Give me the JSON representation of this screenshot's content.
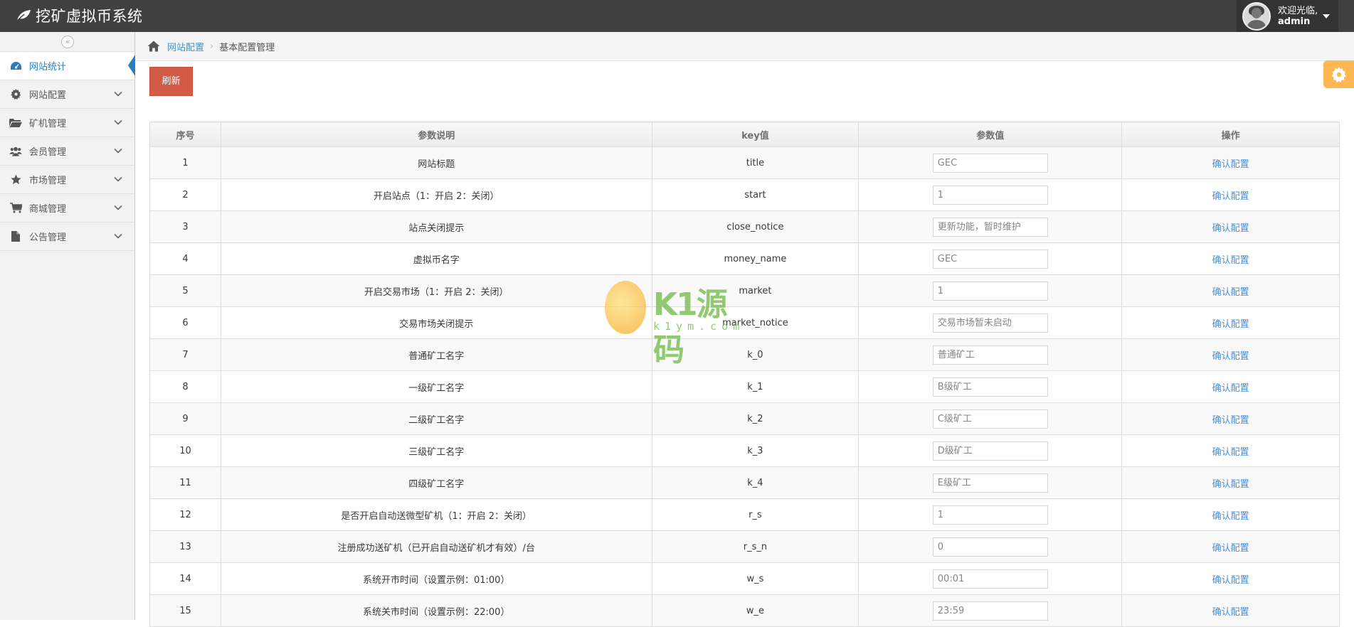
{
  "app": {
    "title": "挖矿虚拟币系统"
  },
  "user": {
    "greeting": "欢迎光临,",
    "name": "admin"
  },
  "sidebar": {
    "collapse_label": "«",
    "items": [
      {
        "label": "网站统计",
        "icon": "dashboard-icon",
        "active": true
      },
      {
        "label": "网站配置",
        "icon": "gear-icon"
      },
      {
        "label": "矿机管理",
        "icon": "folder-open-icon"
      },
      {
        "label": "会员管理",
        "icon": "users-icon"
      },
      {
        "label": "市场管理",
        "icon": "star-icon"
      },
      {
        "label": "商城管理",
        "icon": "cart-icon"
      },
      {
        "label": "公告管理",
        "icon": "file-icon"
      }
    ]
  },
  "breadcrumb": {
    "parent": "网站配置",
    "separator": "›",
    "current": "基本配置管理"
  },
  "toolbar": {
    "refresh_label": "刷新"
  },
  "table": {
    "headers": [
      "序号",
      "参数说明",
      "key值",
      "参数值",
      "操作"
    ],
    "action_label": "确认配置",
    "rows": [
      {
        "id": "1",
        "desc": "网站标题",
        "key": "title",
        "value": "GEC"
      },
      {
        "id": "2",
        "desc": "开启站点（1：开启 2：关闭）",
        "key": "start",
        "value": "1"
      },
      {
        "id": "3",
        "desc": "站点关闭提示",
        "key": "close_notice",
        "value": "更新功能，暂时维护"
      },
      {
        "id": "4",
        "desc": "虚拟币名字",
        "key": "money_name",
        "value": "GEC"
      },
      {
        "id": "5",
        "desc": "开启交易市场（1：开启 2：关闭）",
        "key": "market",
        "value": "1"
      },
      {
        "id": "6",
        "desc": "交易市场关闭提示",
        "key": "market_notice",
        "value": "交易市场暂未启动"
      },
      {
        "id": "7",
        "desc": "普通矿工名字",
        "key": "k_0",
        "value": "普通矿工"
      },
      {
        "id": "8",
        "desc": "一级矿工名字",
        "key": "k_1",
        "value": "B级矿工"
      },
      {
        "id": "9",
        "desc": "二级矿工名字",
        "key": "k_2",
        "value": "C级矿工"
      },
      {
        "id": "10",
        "desc": "三级矿工名字",
        "key": "k_3",
        "value": "D级矿工"
      },
      {
        "id": "11",
        "desc": "四级矿工名字",
        "key": "k_4",
        "value": "E级矿工"
      },
      {
        "id": "12",
        "desc": "是否开启自动送微型矿机（1：开启 2：关闭）",
        "key": "r_s",
        "value": "1"
      },
      {
        "id": "13",
        "desc": "注册成功送矿机（已开启自动送矿机才有效）/台",
        "key": "r_s_n",
        "value": "0"
      },
      {
        "id": "14",
        "desc": "系统开市时间（设置示例：01:00）",
        "key": "w_s",
        "value": "00:01"
      },
      {
        "id": "15",
        "desc": "系统关市时间（设置示例：22:00）",
        "key": "w_e",
        "value": "23:59"
      }
    ]
  },
  "watermark": {
    "text": "K1源码",
    "sub": "k1ym.com"
  },
  "colors": {
    "navbar": "#404040",
    "active": "#2b7dbc",
    "refresh": "#d15b47",
    "settings": "#ffb752",
    "link": "#4a90d9"
  }
}
